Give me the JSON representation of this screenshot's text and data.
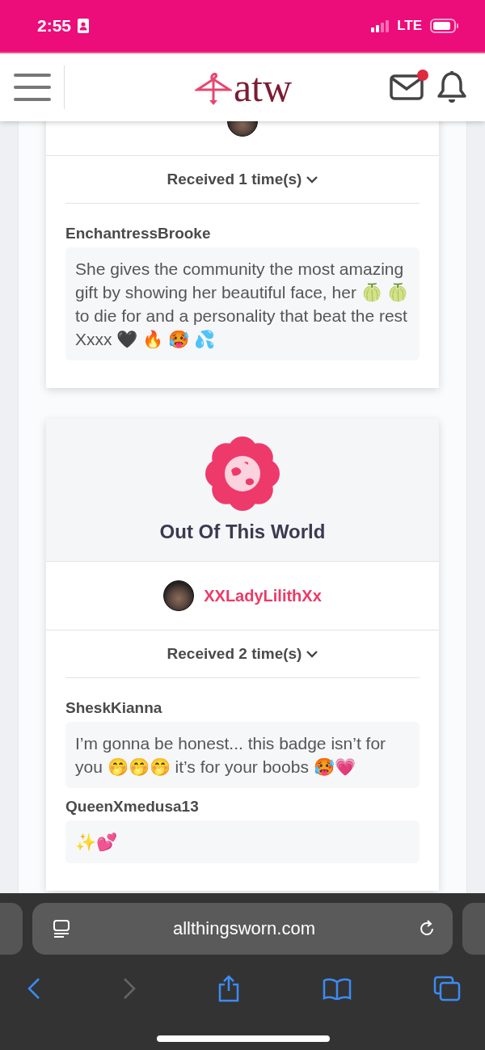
{
  "status_bar": {
    "time": "2:55",
    "network": "LTE"
  },
  "header": {
    "logo": "atw",
    "mail_unread": true
  },
  "cards": [
    {
      "received": "Received 1 time(s)",
      "comments": [
        {
          "author": "EnchantressBrooke",
          "text": "She gives the community the most amazing gift by showing her beautiful face, her 🍈 🍈 to die for and a personality that beat the rest Xxxx 🖤 🔥 🥵 💦"
        }
      ]
    },
    {
      "title": "Out Of This World",
      "recipient": "XXLadyLilithXx",
      "received": "Received 2 time(s)",
      "comments": [
        {
          "author": "SheskKianna",
          "text": "I’m gonna be honest... this badge isn’t for you 🤭🤭🤭 it’s for your boobs 🥵💗"
        },
        {
          "author": "QueenXmedusa13",
          "text": "✨💕"
        }
      ]
    }
  ],
  "browser": {
    "url": "allthingsworn.com"
  }
}
